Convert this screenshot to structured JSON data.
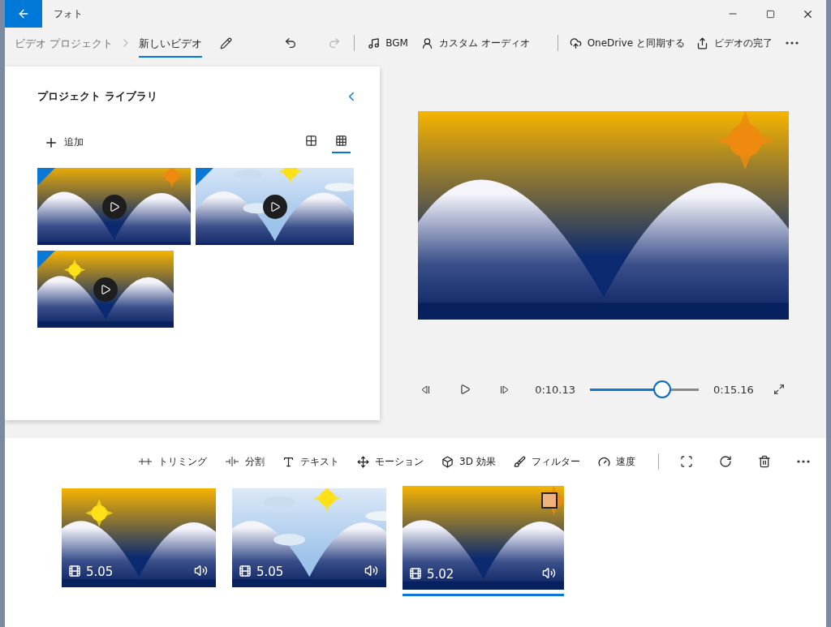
{
  "window": {
    "title": "フォト"
  },
  "header": {
    "breadcrumb": [
      {
        "label": "ビデオ プロジェクト",
        "selected": false
      },
      {
        "label": "新しいビデオ",
        "selected": true
      }
    ],
    "undo": {
      "disabled": false
    },
    "redo": {
      "disabled": true
    },
    "actions": [
      {
        "label": "BGM"
      },
      {
        "label": "カスタム オーディオ"
      },
      {
        "label": "OneDrive と同期する"
      },
      {
        "label": "ビデオの完了"
      }
    ]
  },
  "library": {
    "title": "プロジェクト ライブラリ",
    "add_label": "追加",
    "views": [
      {
        "kind": "large",
        "selected": false
      },
      {
        "kind": "small",
        "selected": true
      }
    ],
    "items": [
      {
        "kind": "picture",
        "used": true
      },
      {
        "kind": "picture",
        "used": true
      },
      {
        "kind": "picture",
        "used": true
      }
    ]
  },
  "player": {
    "current": "0:10.13",
    "total": "0:15.16",
    "level": 0.65
  },
  "storyboard": {
    "tools": [
      {
        "label": "トリミング"
      },
      {
        "label": "分割"
      },
      {
        "label": "テキスト"
      },
      {
        "label": "モーション"
      },
      {
        "label": "3D 効果"
      },
      {
        "label": "フィルター"
      },
      {
        "label": "速度"
      }
    ],
    "clips": [
      {
        "kind": "picture",
        "duration": "5.05",
        "selected": false
      },
      {
        "kind": "picture",
        "duration": "5.05",
        "selected": false
      },
      {
        "kind": "picture",
        "duration": "5.02",
        "selected": true
      }
    ]
  }
}
